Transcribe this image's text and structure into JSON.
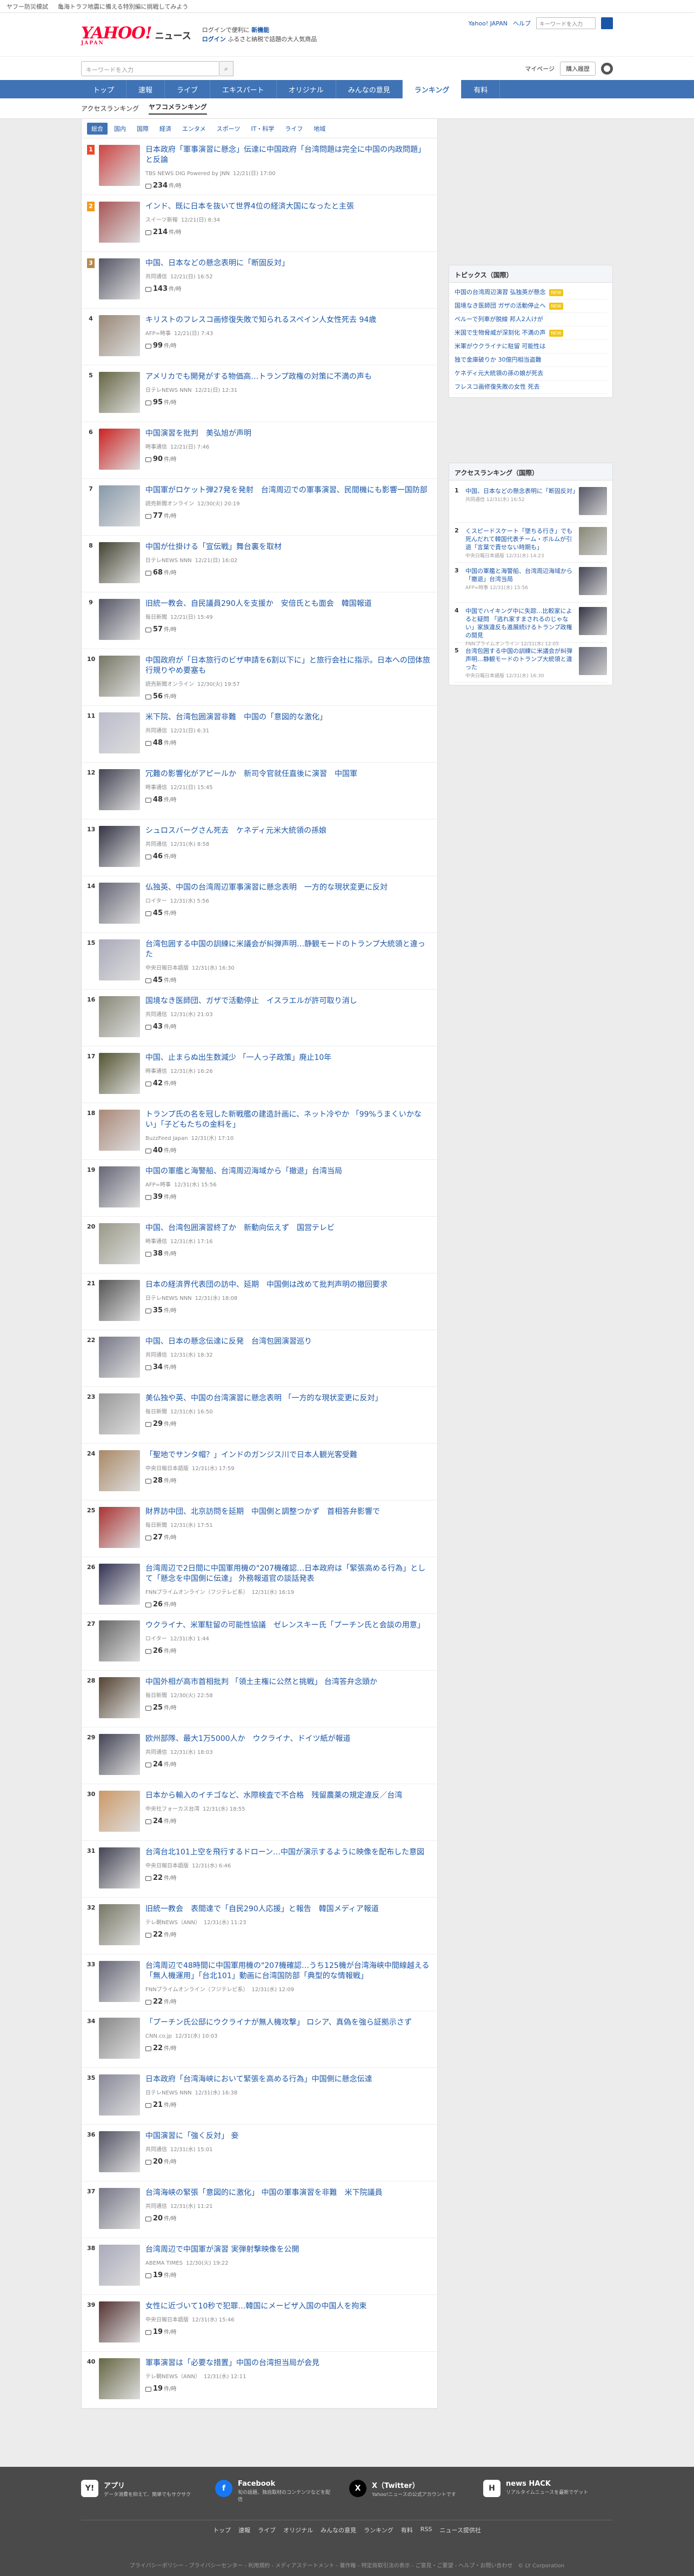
{
  "promo": {
    "left": "ヤフー防災模試",
    "middle": "亀海トラフ地震に備える特別編に挑戦してみよう",
    "right": ""
  },
  "header": {
    "logo": "YAHOO!",
    "logo_sub": "JAPAN",
    "title": "ニュース",
    "promo1": "ログイン",
    "promo_line1": "ログインで便利に",
    "promo_line1b": "新機能",
    "promo_line2": "ふるさと納税で話題の大人気商品",
    "links": [
      "Yahoo! JAPAN",
      "ヘルプ"
    ],
    "search_placeholder": "キーワードを入力"
  },
  "search_row": {
    "placeholder": "キーワードを入力",
    "my_page": "マイページ",
    "buy": "購入履歴"
  },
  "nav": [
    "トップ",
    "速報",
    "ライブ",
    "エキスパート",
    "オリジナル",
    "みんなの意見",
    "ランキング",
    "有料"
  ],
  "subnav": [
    "アクセスランキング",
    "ヤフコメランキング"
  ],
  "cat_tabs": [
    "総合",
    "国内",
    "国際",
    "経済",
    "エンタメ",
    "スポーツ",
    "IT・科学",
    "ライフ",
    "地域"
  ],
  "ranking": [
    {
      "n": "1",
      "title": "日本政府「軍事演習に懸念」伝達に中国政府「台湾問題は完全に中国の内政問題」と反論",
      "src": "TBS NEWS DIG Powered by JNN",
      "time": "12/21(日) 17:00",
      "count": "234",
      "unit": "件/時"
    },
    {
      "n": "2",
      "title": "インド、既に日本を抜いて世界4位の経済大国になったと主張",
      "src": "スイーツ新報",
      "time": "12/21(日) 8:34",
      "count": "214",
      "unit": "件/時"
    },
    {
      "n": "3",
      "title": "中国、日本などの懸念表明に「断固反対」",
      "src": "共同通信",
      "time": "12/21(日) 16:52",
      "count": "143",
      "unit": "件/時"
    },
    {
      "n": "4",
      "title": "キリストのフレスコ画修復失敗で知られるスペイン人女性死去 94歳",
      "src": "AFP=時事",
      "time": "12/21(日) 7:43",
      "count": "99",
      "unit": "件/時"
    },
    {
      "n": "5",
      "title": "アメリカでも開発がする物価高…トランプ政権の対策に不満の声も",
      "src": "日テレNEWS NNN",
      "time": "12/21(日) 12:31",
      "count": "95",
      "unit": "件/時"
    },
    {
      "n": "6",
      "title": "中国演習を批判　美弘旭が声明",
      "src": "時事通信",
      "time": "12/21(日) 7:46",
      "count": "90",
      "unit": "件/時"
    },
    {
      "n": "7",
      "title": "中国軍がロケット弾27発を発射　台湾周辺での軍事演習、民間機にも影響一国防部",
      "src": "読売新聞オンライン",
      "time": "12/30(火) 20:19",
      "count": "77",
      "unit": "件/時"
    },
    {
      "n": "8",
      "title": "中国が仕掛ける「宣伝戦」舞台裏を取材",
      "src": "日テレNEWS NNN",
      "time": "12/21(日) 16:02",
      "count": "68",
      "unit": "件/時"
    },
    {
      "n": "9",
      "title": "旧統一教会、自民議員290人を支援か　安倍氏とも面会　韓国報道",
      "src": "毎日新聞",
      "time": "12/21(日) 15:49",
      "count": "57",
      "unit": "件/時"
    },
    {
      "n": "10",
      "title": "中国政府が「日本旅行のビザ申請を6割以下に」と旅行会社に指示。日本への団体旅行規りやめ要塞も",
      "src": "読売新聞オンライン",
      "time": "12/30(火) 19:57",
      "count": "56",
      "unit": "件/時"
    },
    {
      "n": "11",
      "title": "米下院、台湾包囲演習非難　中国の「意図的な激化」",
      "src": "共同通信",
      "time": "12/21(日) 6:31",
      "count": "48",
      "unit": "件/時"
    },
    {
      "n": "12",
      "title": "冗難の影響化がアピールか　新司令官就任直後に演習　中国軍",
      "src": "時事通信",
      "time": "12/21(日) 15:45",
      "count": "48",
      "unit": "件/時"
    },
    {
      "n": "13",
      "title": "シュロスバーグさん死去　ケネディ元米大統領の孫娘",
      "src": "共同通信",
      "time": "12/31(水) 8:58",
      "count": "46",
      "unit": "件/時"
    },
    {
      "n": "14",
      "title": "仏独英、中国の台湾周辺軍事演習に懸念表明　一方的な現状変更に反対",
      "src": "ロイター",
      "time": "12/31(水) 5:56",
      "count": "45",
      "unit": "件/時"
    },
    {
      "n": "15",
      "title": "台湾包囲する中国の訓練に米議会が糾弾声明…静観モードのトランプ大統領と違った",
      "src": "中央日報日本語版",
      "time": "12/31(水) 16:30",
      "count": "45",
      "unit": "件/時"
    },
    {
      "n": "16",
      "title": "国境なき医師団、ガザで活動停止　イスラエルが許可取り消し",
      "src": "共同通信",
      "time": "12/31(水) 21:03",
      "count": "43",
      "unit": "件/時"
    },
    {
      "n": "17",
      "title": "中国、止まらぬ出生数減少 「一人っ子政策」廃止10年",
      "src": "時事通信",
      "time": "12/31(水) 16:26",
      "count": "42",
      "unit": "件/時"
    },
    {
      "n": "18",
      "title": "トランプ氏の名を冠した新戦艦の建造計画に、ネット冷やか 「99%うまくいかない」「子どもたちの金料を」",
      "src": "BuzzFeed Japan",
      "time": "12/31(水) 17:10",
      "count": "40",
      "unit": "件/時"
    },
    {
      "n": "19",
      "title": "中国の軍艦と海警船、台湾周辺海域から「撤退」台湾当局",
      "src": "AFP=時事",
      "time": "12/31(水) 15:56",
      "count": "39",
      "unit": "件/時"
    },
    {
      "n": "20",
      "title": "中国、台湾包囲演習終了か　新動向伝えず　国営テレビ",
      "src": "時事通信",
      "time": "12/31(水) 17:16",
      "count": "38",
      "unit": "件/時"
    },
    {
      "n": "21",
      "title": "日本の経済界代表団の訪中、延期　中国側は改めて批判声明の撤回要求",
      "src": "日テレNEWS NNN",
      "time": "12/31(水) 18:08",
      "count": "35",
      "unit": "件/時"
    },
    {
      "n": "22",
      "title": "中国、日本の懸念伝達に反発　台湾包囲演習巡り",
      "src": "共同通信",
      "time": "12/31(水) 18:32",
      "count": "34",
      "unit": "件/時"
    },
    {
      "n": "23",
      "title": "美仏独や英、中国の台湾演習に懸念表明 「一方的な現状変更に反対」",
      "src": "毎日新聞",
      "time": "12/31(水) 16:50",
      "count": "29",
      "unit": "件/時"
    },
    {
      "n": "24",
      "title": "「聖地でサンタ帽？」インドのガンジス川で日本人観光客受難",
      "src": "中央日報日本語版",
      "time": "12/31(水) 17:59",
      "count": "28",
      "unit": "件/時"
    },
    {
      "n": "25",
      "title": "財界訪中団、北京訪問を延期　中国側と調整つかず　首相答弁影響で",
      "src": "毎日新聞",
      "time": "12/31(水) 17:51",
      "count": "27",
      "unit": "件/時"
    },
    {
      "n": "26",
      "title": "台湾周辺で2日間に中国軍用機の\"207機確認…日本政府は「緊張高める行為」として「懸念を中国側に伝達」 外務報道官の談話発表",
      "src": "FNNプライムオンライン（フジテレビ系）",
      "time": "12/31(水) 16:19",
      "count": "26",
      "unit": "件/時"
    },
    {
      "n": "27",
      "title": "ウクライナ、米軍駐留の可能性協議　ゼレンスキー氏「プーチン氏と会談の用意」",
      "src": "ロイター",
      "time": "12/31(水) 1:44",
      "count": "26",
      "unit": "件/時"
    },
    {
      "n": "28",
      "title": "中国外相が高市首相批判 「領土主権に公然と挑戦」 台湾答弁念頭か",
      "src": "毎日新聞",
      "time": "12/30(火) 22:58",
      "count": "25",
      "unit": "件/時"
    },
    {
      "n": "29",
      "title": "欧州部隊、最大1万5000人か　ウクライナ、ドイツ紙が報道",
      "src": "共同通信",
      "time": "12/31(水) 18:03",
      "count": "24",
      "unit": "件/時"
    },
    {
      "n": "30",
      "title": "日本から輸入のイチゴなど、水際検査で不合格　残留農薬の規定違反／台湾",
      "src": "中央社フォーカス台湾",
      "time": "12/31(水) 18:55",
      "count": "24",
      "unit": "件/時"
    },
    {
      "n": "31",
      "title": "台湾台北101上空を飛行するドローン…中国が演示するように映像を配布した意図",
      "src": "中央日報日本語版",
      "time": "12/31(水) 6:46",
      "count": "22",
      "unit": "件/時"
    },
    {
      "n": "32",
      "title": "旧統一教会　表間達で「自民290人応援」と報告　韓国メディア報道",
      "src": "テレ朝NEWS（ANN）",
      "time": "12/31(水) 11:23",
      "count": "22",
      "unit": "件/時"
    },
    {
      "n": "33",
      "title": "台湾周辺で48時間に中国軍用機の\"207機確認…うち125機が台湾海峡中間線越える 「無人機運用」「台北101」動画に台湾国防部「典型的な情報戦」",
      "src": "FNNプライムオンライン（フジテレビ系）",
      "time": "12/31(水) 12:09",
      "count": "22",
      "unit": "件/時"
    },
    {
      "n": "34",
      "title": "「プーチン氏公邸にウクライナが無人機攻撃」 ロシア、真偽を強ら証拠示さず",
      "src": "CNN.co.jp",
      "time": "12/31(水) 10:03",
      "count": "22",
      "unit": "件/時"
    },
    {
      "n": "35",
      "title": "日本政府「台湾海峡において緊張を高める行為」中国側に懸念伝達",
      "src": "日テレNEWS NNN",
      "time": "12/31(水) 16:38",
      "count": "21",
      "unit": "件/時"
    },
    {
      "n": "36",
      "title": "中国演習に「強く反対」 妾",
      "src": "共同通信",
      "time": "12/31(水) 15:01",
      "count": "20",
      "unit": "件/時"
    },
    {
      "n": "37",
      "title": "台湾海峡の緊張「意図的に激化」 中国の軍事演習を非難　米下院議員",
      "src": "共同通信",
      "time": "12/31(水) 11:21",
      "count": "20",
      "unit": "件/時"
    },
    {
      "n": "38",
      "title": "台湾周辺で中国軍が演習 実弾射撃映像を公開",
      "src": "ABEMA TIMES",
      "time": "12/30(火) 19:22",
      "count": "19",
      "unit": "件/時"
    },
    {
      "n": "39",
      "title": "女性に近づいて10秒で犯罪…韓国にメービザ入国の中国人を拘束",
      "src": "中央日報日本語版",
      "time": "12/31(水) 15:46",
      "count": "19",
      "unit": "件/時"
    },
    {
      "n": "40",
      "title": "軍事演習は「必要な措置」中国の台湾担当局が会見",
      "src": "テレ朝NEWS（ANN）",
      "time": "12/31(水) 12:11",
      "count": "19",
      "unit": "件/時"
    }
  ],
  "topics": {
    "title": "トピックス（国際）",
    "items": [
      {
        "text": "中国の台湾周辺演習 弘独英が懸念",
        "badge": "NEW"
      },
      {
        "text": "国境なき医師団 ガザの活動停止へ",
        "badge": "NEW"
      },
      {
        "text": "ペルーで列車が脱線 邦人2人けが",
        "badge": ""
      },
      {
        "text": "米国で生物脅威が深刻化 不満の声",
        "badge": "NEW"
      },
      {
        "text": "米軍がウクライナに駐留 可能性は",
        "badge": ""
      },
      {
        "text": "独で金庫破りか 30億円相当盗難",
        "badge": ""
      },
      {
        "text": "ケネディ元大統領の孫の娘が死去",
        "badge": ""
      },
      {
        "text": "フレスコ画修復失敗の女性 死去",
        "badge": ""
      }
    ]
  },
  "access": {
    "title": "アクセスランキング（国際）",
    "items": [
      {
        "n": "1",
        "text": "中国、日本などの懸念表明に「断固反対」",
        "meta": "共同通信 12/31(水) 16:52"
      },
      {
        "n": "2",
        "text": "くスピードスケート「墜ちる行き」でも死んだれて韓国代表チーム・ボルムが引退「言葉で責せない時期も」",
        "meta": "中央日報日本語版 12/31(水) 14:23"
      },
      {
        "n": "3",
        "text": "中国の軍艦と海警船、台湾周辺海域から「撤退」台湾当局",
        "meta": "AFP=時事 12/31(水) 15:56"
      },
      {
        "n": "4",
        "text": "中国でハイキング中に失踪…比較家によると疑問 「逃れ家すまされるのじゃない」家族違反も進展続けるトランプ政権の間見",
        "meta": "FNNプライムオンライン 12/31(水) 12:05"
      },
      {
        "n": "5",
        "text": "台湾包囲する中国の訓練に米議会が糾弾声明…静観モードのトランプ大統領と違った",
        "meta": "中央日報日本語版 12/31(水) 16:30"
      }
    ]
  },
  "footer": {
    "cols": [
      {
        "icon": "Y!",
        "head": "アプリ",
        "desc": "データ消費を抑えて、簡単でもサクサク"
      },
      {
        "icon": "f",
        "head": "Facebook",
        "desc": "旬の話題、独自取材のコンテンツなどを配信"
      },
      {
        "icon": "X",
        "head": "X（Twitter）",
        "desc": "Yahoo!ニュースの公式アカウントです"
      },
      {
        "icon": "H",
        "head": "news HACK",
        "desc": "リアルタイムニュースを最新でゲット"
      }
    ],
    "links": [
      "トップ",
      "速報",
      "ライブ",
      "オリジナル",
      "みんなの意見",
      "ランキング",
      "有料",
      "RSS",
      "ニュース提供社"
    ],
    "legal": "プライバシーポリシー - プライバシーセンター - 利用規約 - メディアステートメント - 著作権 - 特定商取引法の表示 - ご意見・ご要望 - ヘルプ・お問い合わせ　© LY Corporation"
  }
}
